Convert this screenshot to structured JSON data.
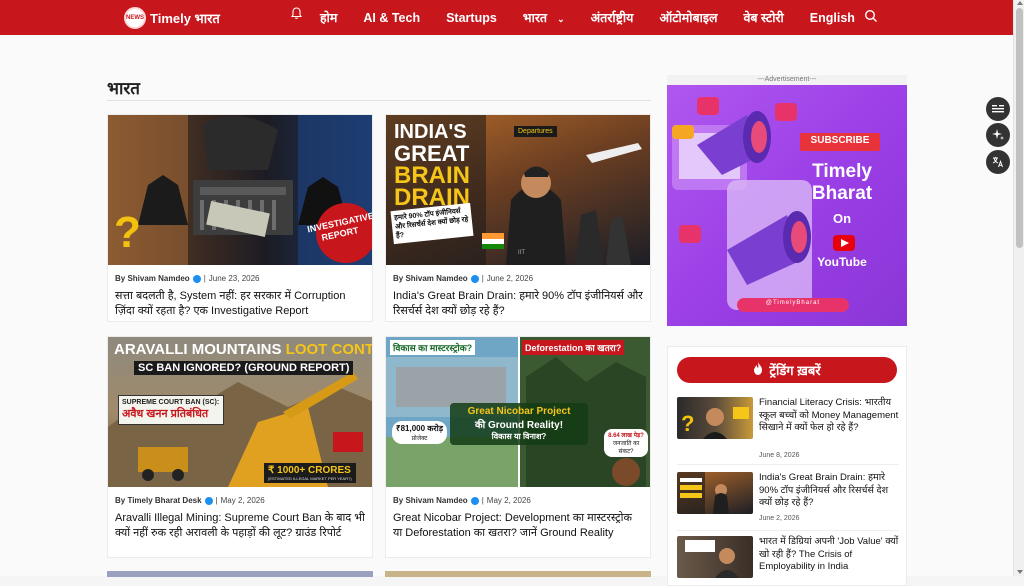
{
  "site": {
    "logo_badge": "NEWS",
    "logo_text": "Timely भारत"
  },
  "nav": [
    {
      "label": "होम"
    },
    {
      "label": "AI & Tech"
    },
    {
      "label": "Startups"
    },
    {
      "label": "भारत",
      "has_dropdown": true
    },
    {
      "label": "अंतर्राष्ट्रीय"
    },
    {
      "label": "ऑटोमोबाइल"
    },
    {
      "label": "वेब स्टोरी"
    },
    {
      "label": "English"
    }
  ],
  "icons": {
    "bell": "bell-icon",
    "search": "search-icon"
  },
  "section": {
    "title": "भारत"
  },
  "articles": [
    {
      "author": "By Shivam Namdeo",
      "date": "June 23, 2026",
      "title": "सत्ता बदलती है, System नहीं: हर सरकार में Corruption ज़िंदा क्यों रहता है? एक Investigative Report",
      "img_text": [
        "INVESTIGATIVE",
        "REPORT"
      ]
    },
    {
      "author": "By Shivam Namdeo",
      "date": "June 2, 2026",
      "title": "India's Great Brain Drain: हमारे 90% टॉप इंजीनियर्स और रिसर्चर्स देश क्यों छोड़ रहे हैं?",
      "img_text": [
        "INDIA'S",
        "GREAT",
        "BRAIN",
        "DRAIN",
        "हमारे 90% टॉप इंजीनियर्स और रिसर्चर्स देश क्यों छोड़ रहे हैं?",
        "Departures",
        "IIT"
      ]
    },
    {
      "author": "By Timely Bharat Desk",
      "date": "May 2, 2026",
      "title": "Aravalli Illegal Mining: Supreme Court Ban के बाद भी क्यों नहीं रुक रही अरावली के पहाड़ों की लूट? ग्राउंड रिपोर्ट",
      "img_text": [
        "ARAVALLI MOUNTAINS",
        "LOOT CONTINUES!",
        "SC BAN IGNORED? (GROUND REPORT)",
        "SUPREME COURT BAN (SC):",
        "अवैध खनन प्रतिबंधित",
        "₹ 1000+ CRORES",
        "(ESTIMATED ILLEGAL MARKET PER YEAR?)"
      ]
    },
    {
      "author": "By Shivam Namdeo",
      "date": "May 2, 2026",
      "title": "Great Nicobar Project: Development का मास्टरस्ट्रोक या Deforestation का खतरा? जानें Ground Reality",
      "img_text": [
        "विकास का मास्टरस्ट्रोक?",
        "Deforestation का खतरा?",
        "Great Nicobar Project",
        "की Ground Reality!",
        "विकास या विनाश?",
        "₹81,000 करोड़",
        "प्रोजेक्ट",
        "8.64 लाख पेड़?",
        "जनजाति का संकट?"
      ]
    }
  ],
  "ad": {
    "label": "---Advertisement---",
    "subscribe": "SUBSCRIBE",
    "line1": "Timely",
    "line2": "Bharat",
    "line3": "On",
    "line4": "YouTube",
    "handle": "@TimelyBharat"
  },
  "trending": {
    "title": "ट्रेंडिंग ख़बरें",
    "items": [
      {
        "title": "Financial Literacy Crisis: भारतीय स्कूल बच्चों को Money Management सिखाने में क्यों फेल हो रहे हैं?",
        "date": "June 8, 2026"
      },
      {
        "title": "India's Great Brain Drain: हमारे 90% टॉप इंजीनियर्स और रिसर्चर्स देश क्यों छोड़ रहे हैं?",
        "date": "June 2, 2026"
      },
      {
        "title": "भारत में डिग्रियां अपनी 'Job Value' क्यों खो रही हैं? The Crisis of Employability in India",
        "date": ""
      }
    ]
  },
  "colors": {
    "brand": "#c8161d",
    "verified": "#1d8ff1"
  }
}
